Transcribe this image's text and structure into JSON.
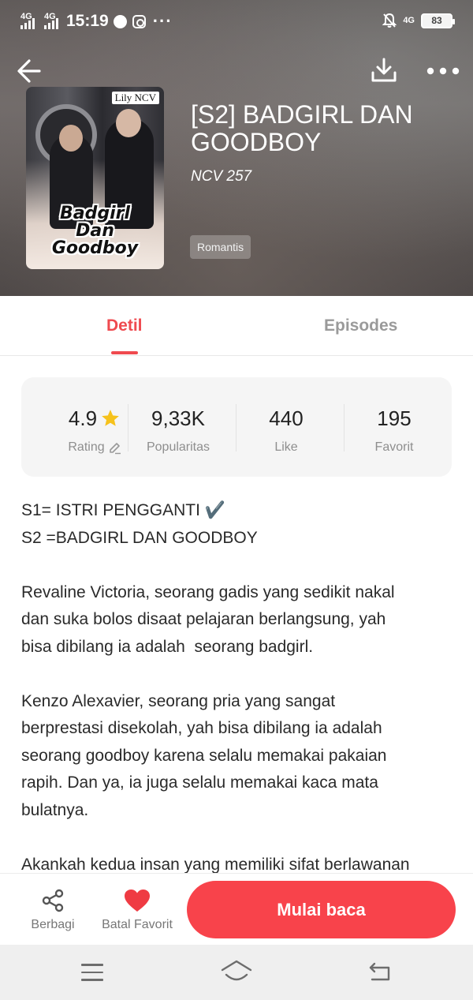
{
  "status_bar": {
    "network_1": "4G",
    "network_2": "4G",
    "time": "15:19",
    "more": "···",
    "lte_label": "4G",
    "battery": "83"
  },
  "book": {
    "title": "[S2] BADGIRL DAN GOODBOY",
    "author": "NCV 257",
    "genre": "Romantis",
    "cover": {
      "author_tag": "Lily NCV",
      "title_lines": [
        "Badgirl",
        "Dan",
        "Goodboy"
      ]
    }
  },
  "tabs": [
    {
      "label": "Detil",
      "active": true
    },
    {
      "label": "Episodes",
      "active": false
    }
  ],
  "stats": [
    {
      "value": "4.9",
      "label": "Rating",
      "icon": "star-icon"
    },
    {
      "value": "9,33K",
      "label": "Popularitas"
    },
    {
      "value": "440",
      "label": "Like"
    },
    {
      "value": "195",
      "label": "Favorit"
    }
  ],
  "description": {
    "p1_line1": "S1= ISTRI PENGGANTI",
    "p1_check": "✔️",
    "p1_line2": "S2 =BADGIRL DAN GOODBOY",
    "p2": [
      "Revaline Victoria, seorang gadis yang sedikit nakal",
      "dan suka bolos disaat pelajaran berlangsung, yah",
      "bisa dibilang ia adalah  seorang badgirl."
    ],
    "p3": [
      "Kenzo Alexavier, seorang pria yang sangat",
      "berprestasi disekolah, yah bisa dibilang ia adalah",
      "seorang goodboy karena selalu memakai pakaian",
      "rapih. Dan ya, ia juga selalu memakai kaca mata",
      "bulatnya."
    ],
    "p4": [
      "Akankah kedua insan yang memiliki sifat berlawanan"
    ]
  },
  "actions": {
    "share_label": "Berbagi",
    "unfavorite_label": "Batal Favorit",
    "read_label": "Mulai baca"
  },
  "colors": {
    "accent": "#ef4a4f",
    "button": "#f8434b",
    "muted": "#9a9a9a"
  }
}
